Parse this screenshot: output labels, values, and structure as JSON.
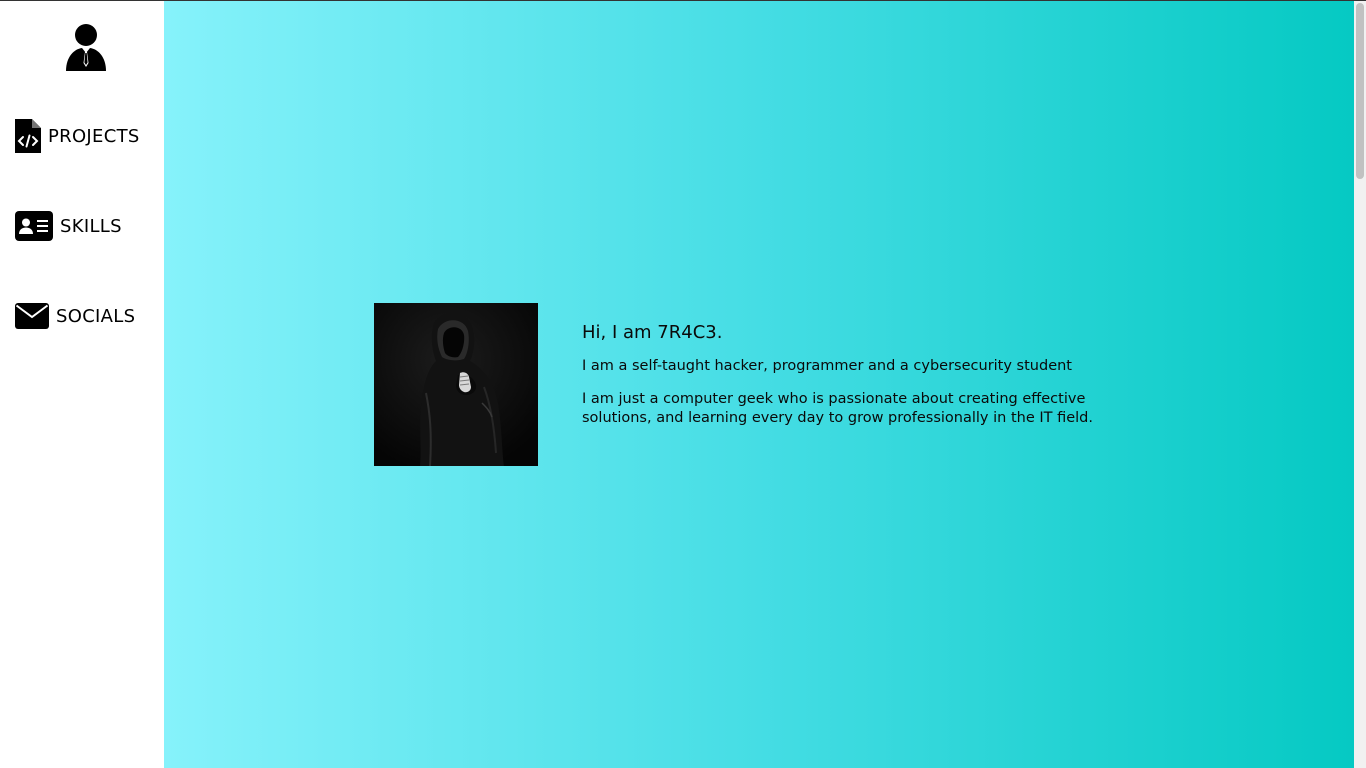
{
  "sidebar": {
    "logo_icon": "businessman-icon",
    "items": [
      {
        "label": "PROJECTS",
        "icon": "code-file-icon"
      },
      {
        "label": "SKILLS",
        "icon": "id-card-icon"
      },
      {
        "label": "SOCIALS",
        "icon": "envelope-icon"
      }
    ]
  },
  "main": {
    "photo_icon": "hooded-figure-photo",
    "heading": "Hi, I am 7R4C3.",
    "tagline": "I am a self-taught hacker, programmer and a cybersecurity student",
    "bio": "I am just a computer geek who is passionate about creating effective solutions, and learning every day to grow professionally in the IT field."
  },
  "colors": {
    "gradient_start": "#86f2fb",
    "gradient_end": "#05c9c3",
    "sidebar_bg": "#ffffff",
    "text": "#000000"
  }
}
